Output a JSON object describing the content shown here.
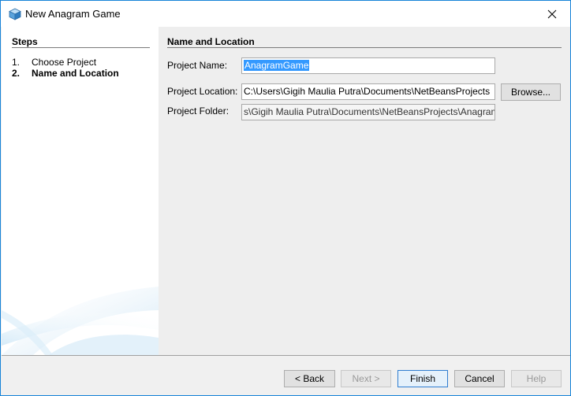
{
  "window": {
    "title": "New Anagram Game",
    "accent_color": "#1783d8"
  },
  "steps": {
    "header": "Steps",
    "items": [
      {
        "number": "1.",
        "label": "Choose Project",
        "current": false
      },
      {
        "number": "2.",
        "label": "Name and Location",
        "current": true
      }
    ]
  },
  "form": {
    "header": "Name and Location",
    "project_name_label": "Project Name:",
    "project_name_value": "AnagramGame",
    "project_location_label": "Project Location:",
    "project_location_value": "C:\\Users\\Gigih Maulia Putra\\Documents\\NetBeansProjects",
    "browse_label": "Browse...",
    "project_folder_label": "Project Folder:",
    "project_folder_value": "s\\Gigih Maulia Putra\\Documents\\NetBeansProjects\\AnagramGame"
  },
  "buttons": {
    "back": "< Back",
    "next": "Next >",
    "finish": "Finish",
    "cancel": "Cancel",
    "help": "Help"
  }
}
